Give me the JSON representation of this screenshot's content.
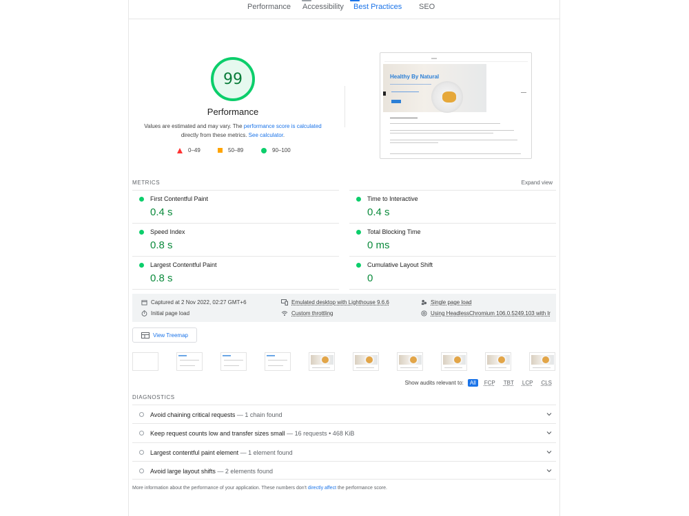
{
  "tabs": [
    {
      "label": "Performance"
    },
    {
      "label": "Accessibility"
    },
    {
      "label": "Best Practices"
    },
    {
      "label": "SEO"
    }
  ],
  "score": {
    "value": "99",
    "label": "Performance",
    "note_prefix": "Values are estimated and may vary. The ",
    "note_link1": "performance score is calculated",
    "note_mid": " directly from these metrics. ",
    "note_link2": "See calculator",
    "note_suffix": ".",
    "legend": [
      {
        "range": "0–49",
        "color": "#ff3333"
      },
      {
        "range": "50–89",
        "color": "#ffa400"
      },
      {
        "range": "90–100",
        "color": "#0cce6b"
      }
    ]
  },
  "screenshot": {
    "site_title": "Healthy By Natural"
  },
  "metrics": {
    "section_title": "METRICS",
    "expand_label": "Expand view",
    "items": [
      {
        "label": "First Contentful Paint",
        "value": "0.4 s"
      },
      {
        "label": "Time to Interactive",
        "value": "0.4 s"
      },
      {
        "label": "Speed Index",
        "value": "0.8 s"
      },
      {
        "label": "Total Blocking Time",
        "value": "0 ms"
      },
      {
        "label": "Largest Contentful Paint",
        "value": "0.8 s"
      },
      {
        "label": "Cumulative Layout Shift",
        "value": "0"
      }
    ]
  },
  "environment": {
    "captured": "Captured at 2 Nov 2022, 02:27 GMT+6",
    "emulated": "Emulated desktop with Lighthouse 9.6.6",
    "single": "Single page load",
    "initial": "Initial page load",
    "throttling": "Custom throttling",
    "browser": "Using HeadlessChromium 106.0.5249.103 with lr"
  },
  "treemap_label": "View Treemap",
  "filters": {
    "label": "Show audits relevant to:",
    "options": [
      "All",
      "FCP",
      "TBT",
      "LCP",
      "CLS"
    ]
  },
  "diagnostics": {
    "section_title": "DIAGNOSTICS",
    "items": [
      {
        "title": "Avoid chaining critical requests",
        "detail": "— 1 chain found"
      },
      {
        "title": "Keep request counts low and transfer sizes small",
        "detail": "— 16 requests • 468 KiB"
      },
      {
        "title": "Largest contentful paint element",
        "detail": "— 1 element found"
      },
      {
        "title": "Avoid large layout shifts",
        "detail": "— 2 elements found"
      }
    ]
  },
  "footer": {
    "prefix": "More information about the performance of your application. These numbers don't ",
    "link": "directly affect",
    "suffix": " the performance score."
  }
}
